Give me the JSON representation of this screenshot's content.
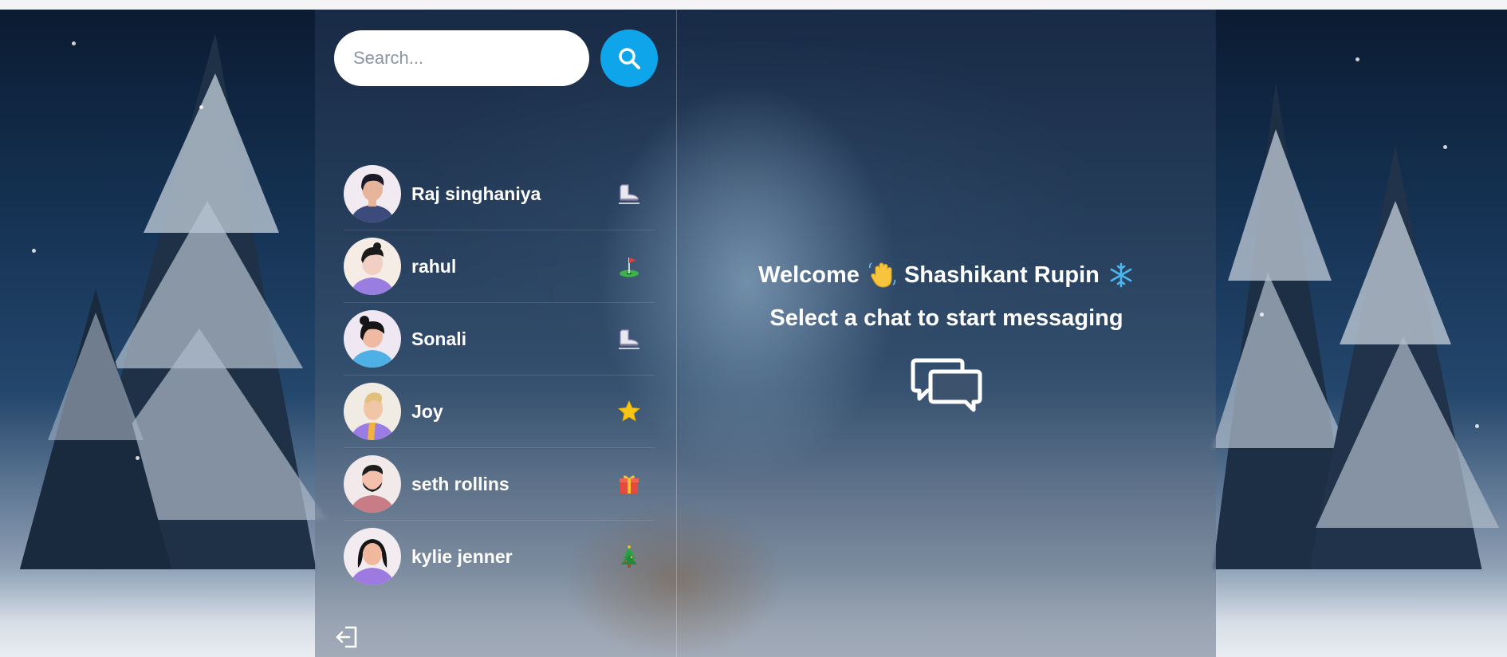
{
  "search": {
    "placeholder": "Search...",
    "icon": "search-icon"
  },
  "chats": [
    {
      "name": "Raj singhaniya",
      "emoji": "ice-skate-icon",
      "avatar_colors": {
        "skin": "#e6b49a",
        "hair": "#1c1a28",
        "shirt": "#3c4a7c",
        "bg": "#f1eaf0"
      }
    },
    {
      "name": "rahul",
      "emoji": "golf-flag-icon",
      "avatar_colors": {
        "skin": "#f1d0c3",
        "hair": "#1b1b1b",
        "shirt": "#9a7de0",
        "bg": "#f5ece6"
      }
    },
    {
      "name": "Sonali",
      "emoji": "ice-skate-icon",
      "avatar_colors": {
        "skin": "#f0b9a1",
        "hair": "#151515",
        "shirt": "#4fb0e6",
        "bg": "#efe7f2"
      }
    },
    {
      "name": "Joy",
      "emoji": "star-icon",
      "avatar_colors": {
        "skin": "#f1c6a6",
        "hair": "#e2c079",
        "shirt": "#9b7ce2",
        "bg": "#f1ece3"
      }
    },
    {
      "name": "seth rollins",
      "emoji": "gift-icon",
      "avatar_colors": {
        "skin": "#f3c0ad",
        "hair": "#1d1d1d",
        "shirt": "#c87d86",
        "bg": "#f1e9ea"
      }
    },
    {
      "name": "kylie jenner",
      "emoji": "christmas-tree-icon",
      "avatar_colors": {
        "skin": "#f0b89d",
        "hair": "#151515",
        "shirt": "#9c7ae0",
        "bg": "#f2ecf0"
      }
    }
  ],
  "welcome": {
    "greeting": "Welcome",
    "user_name": "Shashikant Rupin",
    "subtitle": "Select a chat to start messaging"
  },
  "colors": {
    "accent": "#0ea5ea",
    "text": "#ffffff"
  }
}
